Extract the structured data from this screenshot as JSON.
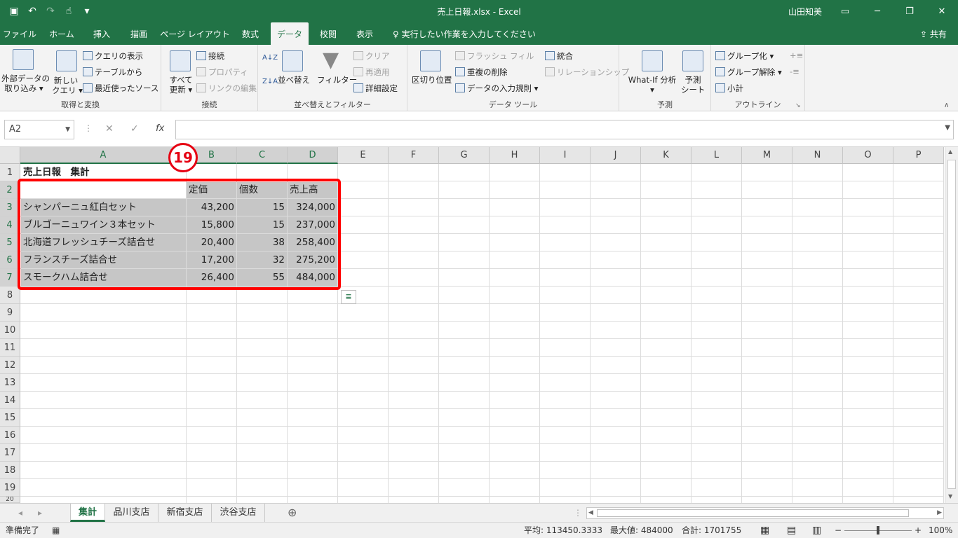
{
  "app": {
    "title": "売上日報.xlsx  -  Excel",
    "user": "山田知美"
  },
  "qat_icons": [
    "save-icon",
    "undo-icon",
    "redo-icon",
    "touch-mode-icon",
    "customize-icon"
  ],
  "tabs": [
    {
      "label": "ファイル"
    },
    {
      "label": "ホーム"
    },
    {
      "label": "挿入"
    },
    {
      "label": "描画"
    },
    {
      "label": "ページ レイアウト"
    },
    {
      "label": "数式"
    },
    {
      "label": "データ"
    },
    {
      "label": "校閲"
    },
    {
      "label": "表示"
    }
  ],
  "tell_me": "実行したい作業を入力してください",
  "share": "共有",
  "ribbon": {
    "get_transform": {
      "label": "取得と変換",
      "external_data_1": "外部データの",
      "external_data_2": "取り込み",
      "new_query_1": "新しい",
      "new_query_2": "クエリ",
      "show_queries": "クエリの表示",
      "from_table": "テーブルから",
      "recent_sources": "最近使ったソース"
    },
    "connections": {
      "label": "接続",
      "refresh_all_1": "すべて",
      "refresh_all_2": "更新",
      "connections": "接続",
      "properties": "プロパティ",
      "edit_links": "リンクの編集"
    },
    "sort_filter": {
      "label": "並べ替えとフィルター",
      "sort": "並べ替え",
      "filter": "フィルター",
      "clear": "クリア",
      "reapply": "再適用",
      "advanced": "詳細設定"
    },
    "data_tools": {
      "label": "データ ツール",
      "text_to_columns": "区切り位置",
      "flash_fill": "フラッシュ フィル",
      "remove_duplicates": "重複の削除",
      "data_validation": "データの入力規則",
      "consolidate": "統合",
      "relationships": "リレーションシップ"
    },
    "forecast": {
      "label": "予測",
      "what_if": "What-If 分析",
      "forecast_sheet_1": "予測",
      "forecast_sheet_2": "シート"
    },
    "outline": {
      "label": "アウトライン",
      "group": "グループ化",
      "ungroup": "グループ解除",
      "subtotal": "小計"
    }
  },
  "formula_bar": {
    "name_box": "A2",
    "fx": "fx",
    "value": ""
  },
  "columns": [
    "A",
    "B",
    "C",
    "D",
    "E",
    "F",
    "G",
    "H",
    "I",
    "J",
    "K",
    "L",
    "M",
    "N",
    "O",
    "P"
  ],
  "rows": [
    "1",
    "2",
    "3",
    "4",
    "5",
    "6",
    "7",
    "8",
    "9",
    "10",
    "11",
    "12",
    "13",
    "14",
    "15",
    "16",
    "17",
    "18",
    "19",
    "20"
  ],
  "cells": {
    "A1": "売上日報　集計",
    "B2": "定価",
    "C2": "個数",
    "D2": "売上高",
    "A3": "シャンパーニュ紅白セット",
    "B3": "43,200",
    "C3": "15",
    "D3": "324,000",
    "A4": "ブルゴーニュワイン３本セット",
    "B4": "15,800",
    "C4": "15",
    "D4": "237,000",
    "A5": "北海道フレッシュチーズ詰合せ",
    "B5": "20,400",
    "C5": "38",
    "D5": "258,400",
    "A6": "フランスチーズ詰合せ",
    "B6": "17,200",
    "C6": "32",
    "D6": "275,200",
    "A7": "スモークハム詰合せ",
    "B7": "26,400",
    "C7": "55",
    "D7": "484,000"
  },
  "annotation": {
    "step": "19"
  },
  "sheets": [
    {
      "label": "集計"
    },
    {
      "label": "品川支店"
    },
    {
      "label": "新宿支店"
    },
    {
      "label": "渋谷支店"
    }
  ],
  "status": {
    "ready": "準備完了",
    "average": "平均: 113450.3333",
    "max": "最大値: 484000",
    "sum": "合計: 1701755",
    "zoom": "100%"
  },
  "colors": {
    "accent": "#217346",
    "highlight": "#ff0000"
  }
}
